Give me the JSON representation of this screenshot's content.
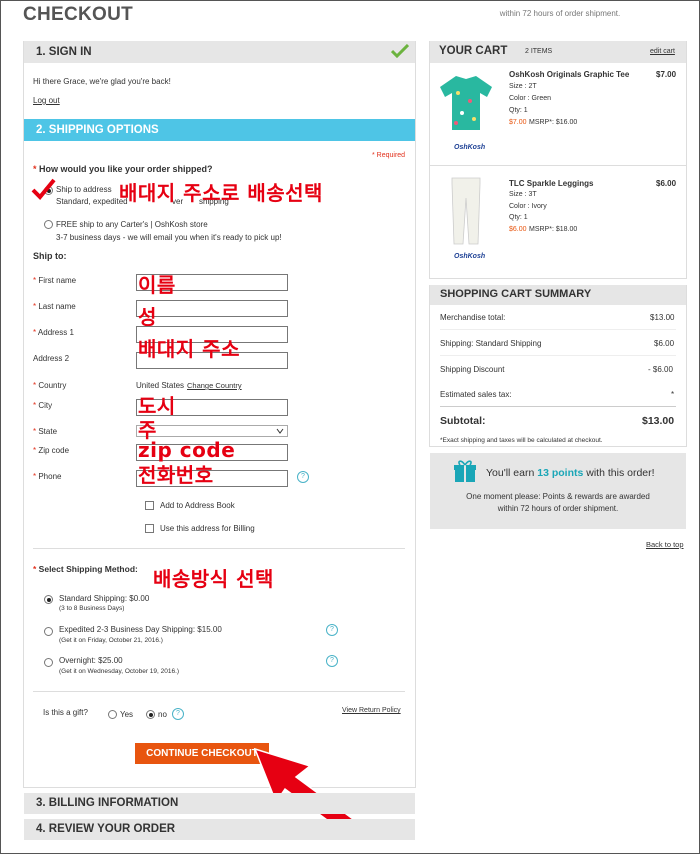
{
  "page": {
    "title": "CHECKOUT",
    "top_note_line2": "within 72 hours of order shipment."
  },
  "sign_in": {
    "header": "1. SIGN IN",
    "greeting": "Hi there Grace, we're glad you're back!",
    "logout": "Log out"
  },
  "shipping": {
    "header": "2. SHIPPING OPTIONS",
    "required": "* Required",
    "question": "How would you like your order shipped?",
    "ship_to_address_label": "Ship to address",
    "ship_to_address_sub": "Standard, expedited",
    "ship_to_address_sub_tail": "ver",
    "ship_to_address_sub_tail2": "shipping",
    "free_ship_label": "FREE ship to any Carter's | OshKosh store",
    "free_ship_sub": "3-7 business days - we will email you when it's ready to pick up!",
    "ship_to_title": "Ship to:",
    "fields": {
      "first_name": "First name",
      "last_name": "Last name",
      "address1": "Address 1",
      "address2": "Address 2",
      "country": "Country",
      "country_value": "United States",
      "change_country": "Change Country",
      "city": "City",
      "state": "State",
      "zip": "Zip code",
      "phone": "Phone"
    },
    "add_to_address_book": "Add to Address Book",
    "use_for_billing": "Use this address for Billing",
    "method_title": "Select Shipping Method:",
    "methods": [
      {
        "label": "Standard Shipping: $0.00",
        "sub": "(3 to 8 Business Days)"
      },
      {
        "label": "Expedited 2-3 Business Day Shipping: $15.00",
        "sub": "(Get it on Friday, October 21, 2016.)"
      },
      {
        "label": "Overnight: $25.00",
        "sub": "(Get it on Wednesday, October 19, 2016.)"
      }
    ],
    "gift_question": "Is this a gift?",
    "gift_yes": "Yes",
    "gift_no": "no",
    "return_policy": "View Return Policy",
    "continue": "CONTINUE CHECKOUT"
  },
  "billing": {
    "header": "3. BILLING INFORMATION"
  },
  "review": {
    "header": "4. REVIEW YOUR ORDER"
  },
  "cart": {
    "title": "YOUR CART",
    "count": "2 ITEMS",
    "edit": "edit cart",
    "items": [
      {
        "name": "OshKosh Originals Graphic Tee",
        "size": "Size : 2T",
        "color": "Color : Green",
        "qty": "Qty: 1",
        "sale": "$7.00",
        "msrp": "MSRP*: $16.00",
        "price": "$7.00",
        "brand": "OshKosh"
      },
      {
        "name": "TLC Sparkle Leggings",
        "size": "Size : 3T",
        "color": "Color : Ivory",
        "qty": "Qty: 1",
        "sale": "$6.00",
        "msrp": "MSRP*: $18.00",
        "price": "$6.00",
        "brand": "OshKosh"
      }
    ]
  },
  "summary": {
    "title": "SHOPPING CART SUMMARY",
    "rows": [
      {
        "label": "Merchandise total:",
        "value": "$13.00"
      },
      {
        "label": "Shipping: Standard Shipping",
        "value": "$6.00"
      },
      {
        "label": "Shipping Discount",
        "value": "- $6.00"
      },
      {
        "label": "Estimated sales tax:",
        "value": "*"
      }
    ],
    "subtotal_label": "Subtotal:",
    "subtotal_value": "$13.00",
    "footnote": "*Exact shipping and taxes will be calculated at checkout."
  },
  "points": {
    "earn_prefix": "You'll earn",
    "earn_points": "13 points",
    "earn_suffix": "with this order!",
    "line1": "One moment please: Points & rewards are awarded",
    "line2": "within 72 hours of order shipment."
  },
  "back_to_top": "Back to top",
  "annotations": {
    "ship_to_address": "배대지 주소로 배송선택",
    "first_name": "이름",
    "last_name": "성",
    "address": "배대지 주소",
    "city": "도시",
    "state": "주",
    "zip": "zip code",
    "phone": "전화번호",
    "method": "배송방식 선택"
  },
  "colors": {
    "accent_blue": "#4ec5e6",
    "cta_orange": "#e8550f",
    "annotation_red": "#e60012",
    "check_green": "#6cb33f"
  }
}
